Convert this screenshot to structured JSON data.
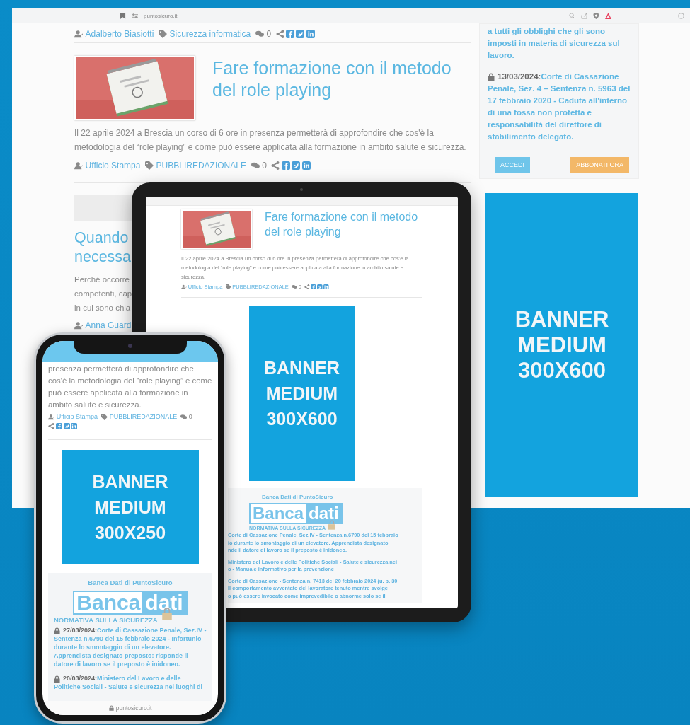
{
  "desktop": {
    "url": "puntosicuro.it",
    "top_meta": {
      "author": "Adalberto Biasiotti",
      "category": "Sicurezza informatica",
      "comments": "0"
    },
    "article": {
      "title": "Fare formazione con il metodo del role playing",
      "excerpt": "Il 22 aprile 2024 a Brescia un corso di 6 ore in presenza permetterà di approfondire che cos'è la metodologia del “role playing” e come può essere applicata alla formazione in ambito salute e sicurezza.",
      "meta": {
        "author": "Ufficio Stampa",
        "category": "PUBBLIREDAZIONALE",
        "comments": "0"
      }
    },
    "next_article": {
      "title_lines": [
        "Quando",
        "necessa"
      ],
      "excerpt_lines": [
        "Perché occorre",
        "competenti, cap",
        "in cui sono chia"
      ],
      "author": "Anna Guard"
    },
    "sidebar": {
      "intro": "a tutti gli obblighi che gli sono imposti in materia di sicurezza sul lavoro.",
      "entries": [
        {
          "date": "13/03/2024:",
          "title": "Corte di Cassazione Penale, Sez. 4 – Sentenza n. 5963 del 17 febbraio 2020 - Caduta all'interno di una fossa non protetta e responsabilità del direttore di stabilimento delegato."
        }
      ],
      "buttons": [
        {
          "label": "ACCEDI",
          "kind": "login"
        },
        {
          "label": "ABBONATI ORA",
          "kind": "subscribe"
        }
      ]
    },
    "banner": "BANNER\nMEDIUM\n300X600"
  },
  "tablet": {
    "article": {
      "title": "Fare formazione con il metodo del role playing",
      "excerpt": "Il 22 aprile 2024 a Brescia un corso di 6 ore in presenza permetterà di approfondire che cos'è la metodologia del “role playing” e come può essere applicata alla formazione in ambito salute e sicurezza.",
      "meta": {
        "author": "Ufficio Stampa",
        "category": "PUBBLIREDAZIONALE",
        "comments": "0"
      }
    },
    "banner": "BANNER\nMEDIUM\n300X600",
    "databank": {
      "title": "Banca Dati di PuntoSicuro",
      "logo_word_1": "Banca",
      "logo_word_2": "dati",
      "tagline": "NORMATIVA SULLA SICUREZZA",
      "entries": [
        "Corte di Cassazione Penale, Sez.IV - Sentenza n.6790 del 15 febbraio\nio durante lo smontaggio di un elevatore. Apprendista designato\nnde il datore di lavoro se il preposto è inidoneo.",
        "Ministero del Lavoro e delle Politiche Sociali - Salute e sicurezza nei\no - Manuale informativo per la prevenzione",
        "Corte di Cassazione - Sentenza n. 7413 del 20 febbraio 2024 (u. p. 30\n Il comportamento avventato del lavoratore tenuto mentre svolge\no può essere invocato come imprevedibile o abnorme solo se il"
      ]
    }
  },
  "phone": {
    "excerpt": "presenza permetterà di approfondire che cos'è la metodologia del “role playing” e come può essere applicata alla formazione in ambito salute e sicurezza.",
    "meta": {
      "author": "Ufficio Stampa",
      "category": "PUBBLIREDAZIONALE",
      "comments": "0"
    },
    "banner": "BANNER\nMEDIUM\n300X250",
    "databank": {
      "title": "Banca Dati di PuntoSicuro",
      "logo_word_1": "Banca",
      "logo_word_2": "dati",
      "tagline": "NORMATIVA SULLA SICUREZZA",
      "entries": [
        {
          "date": "27/03/2024:",
          "title": "Corte di Cassazione Penale, Sez.IV - Sentenza n.6790 del 15 febbraio 2024 - Infortunio durante lo smontaggio di un elevatore. Apprendista designato preposto: risponde il datore di lavoro se il preposto è inidoneo."
        },
        {
          "date": "20/03/2024:",
          "title": "Ministero del Lavoro e delle Politiche Sociali - Salute e sicurezza nei luoghi di"
        }
      ]
    },
    "url": "puntosicuro.it"
  }
}
